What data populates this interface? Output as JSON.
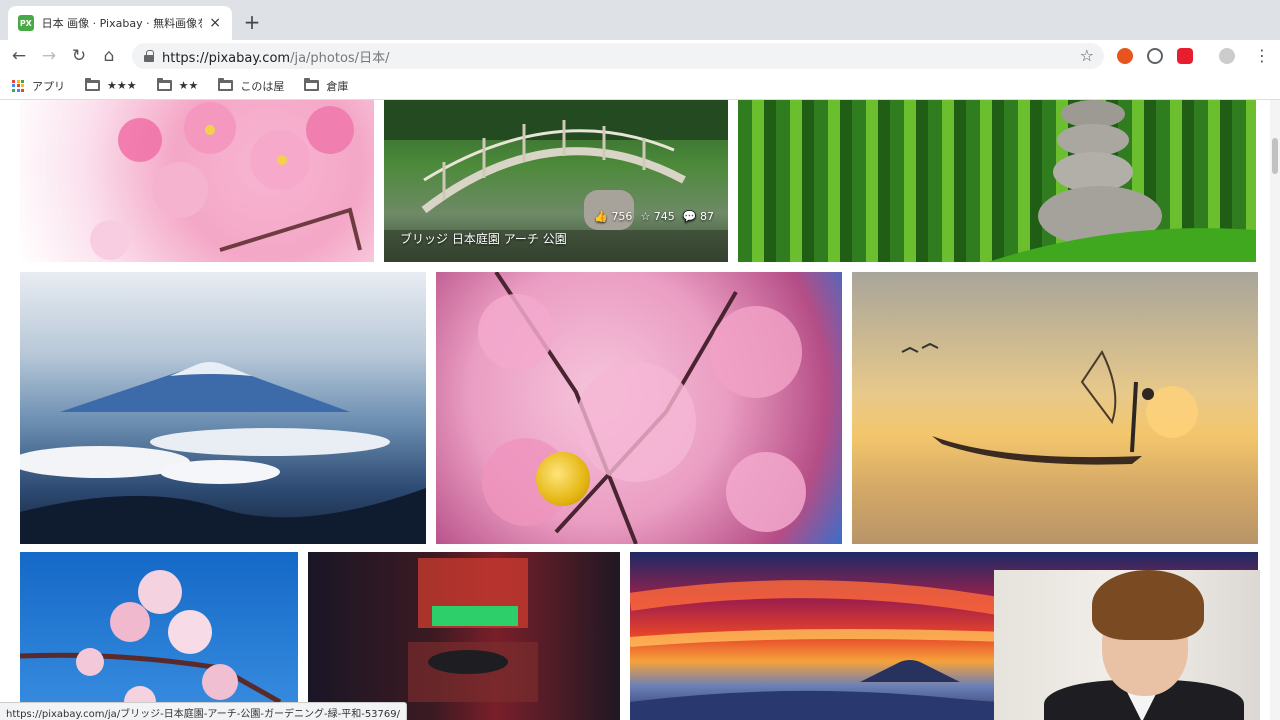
{
  "browser": {
    "tab": {
      "favicon_text": "PX",
      "title": "日本 画像 · Pixabay · 無料画像をダ",
      "close": "×"
    },
    "new_tab": "+",
    "nav": {
      "back": "←",
      "forward": "→",
      "reload": "↻",
      "home": "⌂"
    },
    "url": {
      "host": "https://pixabay.com",
      "path": "/ja/photos/日本/"
    },
    "bookmark_star": "☆",
    "bookmarks": [
      {
        "label": "アプリ",
        "icon": "apps-grid-icon"
      },
      {
        "label": "★★★",
        "icon": "folder-icon"
      },
      {
        "label": "★★",
        "icon": "folder-icon"
      },
      {
        "label": "このは屋",
        "icon": "folder-icon"
      },
      {
        "label": "倉庫",
        "icon": "folder-icon"
      }
    ],
    "extensions": {
      "colors": [
        "#e8541e",
        "#5f6368",
        "#e81e2e"
      ]
    },
    "status_url": "https://pixabay.com/ja/ブリッジ-日本庭園-アーチ-公園-ガーデニング-緑-平和-53769/"
  },
  "gallery": {
    "hovered_photo": {
      "tags": "ブリッジ  日本庭園  アーチ  公園",
      "likes": "756",
      "favorites": "745",
      "comments": "87"
    },
    "photos": [
      {
        "subject": "cherry-blossom-closeup"
      },
      {
        "subject": "japanese-garden-bridge"
      },
      {
        "subject": "bamboo-zen-stones"
      },
      {
        "subject": "mount-fuji-clouds"
      },
      {
        "subject": "sakura-branches-blue-sky"
      },
      {
        "subject": "fisherman-boat-sunset"
      },
      {
        "subject": "sakura-blue-sky"
      },
      {
        "subject": "neon-alley-night"
      },
      {
        "subject": "fuji-sunrise-sky"
      }
    ]
  },
  "colors": {
    "pixabay_green": "#48a947",
    "tabstrip": "#dee1e6"
  }
}
